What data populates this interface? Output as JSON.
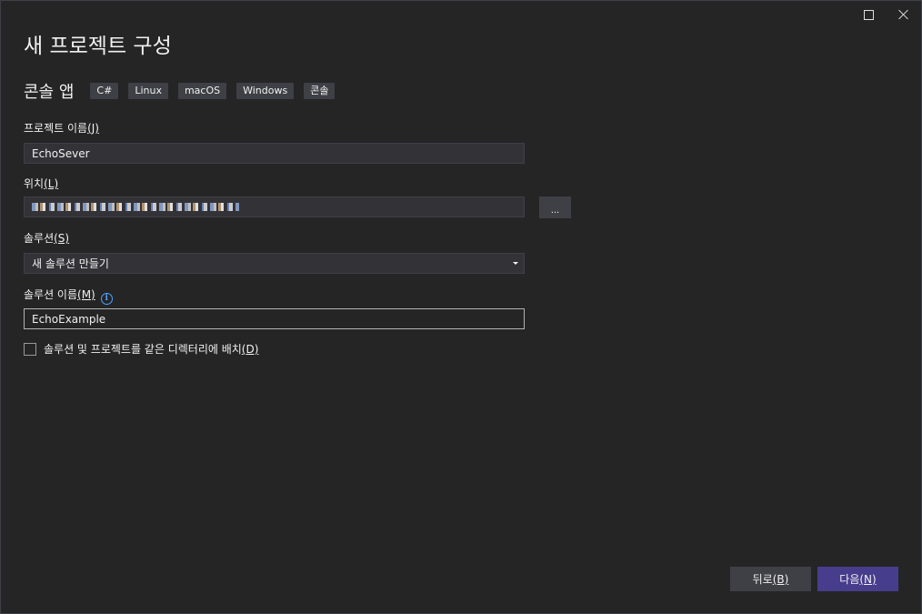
{
  "window": {
    "maximize_icon": "maximize-icon",
    "close_icon": "close-icon"
  },
  "page": {
    "title": "새 프로젝트 구성"
  },
  "template": {
    "name": "콘솔 앱",
    "tags": [
      "C#",
      "Linux",
      "macOS",
      "Windows",
      "콘솔"
    ]
  },
  "project_name": {
    "label": "프로젝트 이름",
    "mnemonic": "(J)",
    "value": "EchoSever"
  },
  "location": {
    "label": "위치",
    "mnemonic": "(L)",
    "browse_label": "..."
  },
  "solution": {
    "label": "솔루션",
    "mnemonic": "(S)",
    "selected": "새 솔루션 만들기"
  },
  "solution_name": {
    "label": "솔루션 이름",
    "mnemonic": "(M)",
    "info_icon": "i",
    "value": "EchoExample"
  },
  "same_directory": {
    "label": "솔루션 및 프로젝트를 같은 디렉터리에 배치",
    "mnemonic": "(D)",
    "checked": false
  },
  "footer": {
    "back_label": "뒤로",
    "back_mnemonic": "(B)",
    "next_label": "다음",
    "next_mnemonic": "(N)"
  },
  "colors": {
    "background": "#252526",
    "input_background": "#333337",
    "tag_background": "#3f3f46",
    "primary_button": "#463d8c",
    "info_blue": "#4da3ff"
  }
}
